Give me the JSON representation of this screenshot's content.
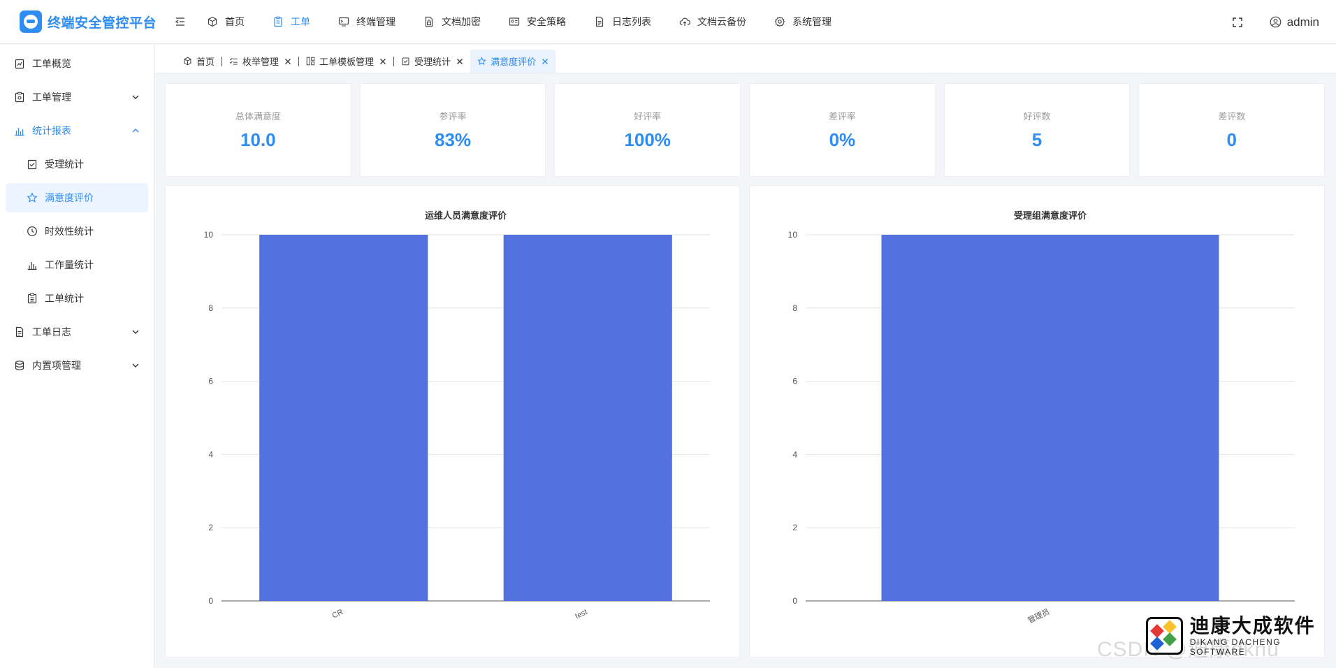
{
  "app": {
    "title": "终端安全管控平台"
  },
  "topnav": [
    {
      "label": "首页",
      "icon": "cube-icon",
      "active": false
    },
    {
      "label": "工单",
      "icon": "clipboard-icon",
      "active": true
    },
    {
      "label": "终端管理",
      "icon": "monitor-icon",
      "active": false
    },
    {
      "label": "文档加密",
      "icon": "file-lock-icon",
      "active": false
    },
    {
      "label": "安全策略",
      "icon": "id-card-icon",
      "active": false
    },
    {
      "label": "日志列表",
      "icon": "document-icon",
      "active": false
    },
    {
      "label": "文档云备份",
      "icon": "cloud-upload-icon",
      "active": false
    },
    {
      "label": "系统管理",
      "icon": "gear-icon",
      "active": false
    }
  ],
  "header": {
    "user": "admin"
  },
  "sidebar": {
    "items": [
      {
        "label": "工单概览"
      },
      {
        "label": "工单管理"
      },
      {
        "label": "统计报表"
      },
      {
        "label": "受理统计"
      },
      {
        "label": "满意度评价"
      },
      {
        "label": "时效性统计"
      },
      {
        "label": "工作量统计"
      },
      {
        "label": "工单统计"
      },
      {
        "label": "工单日志"
      },
      {
        "label": "内置项管理"
      }
    ]
  },
  "tabs": [
    {
      "label": "首页"
    },
    {
      "label": "枚举管理"
    },
    {
      "label": "工单模板管理"
    },
    {
      "label": "受理统计"
    },
    {
      "label": "满意度评价"
    }
  ],
  "stats": [
    {
      "label": "总体满意度",
      "value": "10.0"
    },
    {
      "label": "参评率",
      "value": "83%"
    },
    {
      "label": "好评率",
      "value": "100%"
    },
    {
      "label": "差评率",
      "value": "0%"
    },
    {
      "label": "好评数",
      "value": "5"
    },
    {
      "label": "差评数",
      "value": "0"
    }
  ],
  "colors": {
    "accent": "#2f8cf0",
    "bar": "#5172de"
  },
  "chart_data": [
    {
      "type": "bar",
      "title": "运维人员满意度评价",
      "categories": [
        "CR",
        "test"
      ],
      "values": [
        10,
        10
      ],
      "ylim": [
        0,
        10
      ],
      "yticks": [
        0,
        2,
        4,
        6,
        8,
        10
      ],
      "grid": true
    },
    {
      "type": "bar",
      "title": "受理组满意度评价",
      "categories": [
        "管理员"
      ],
      "values": [
        10
      ],
      "ylim": [
        0,
        10
      ],
      "yticks": [
        0,
        2,
        4,
        6,
        8,
        10
      ],
      "grid": true
    }
  ],
  "watermark": {
    "csdn": "CSDN @迪康dknu",
    "brand_cn": "迪康大成软件",
    "brand_en": "DIKANG DACHENG SOFTWARE"
  }
}
